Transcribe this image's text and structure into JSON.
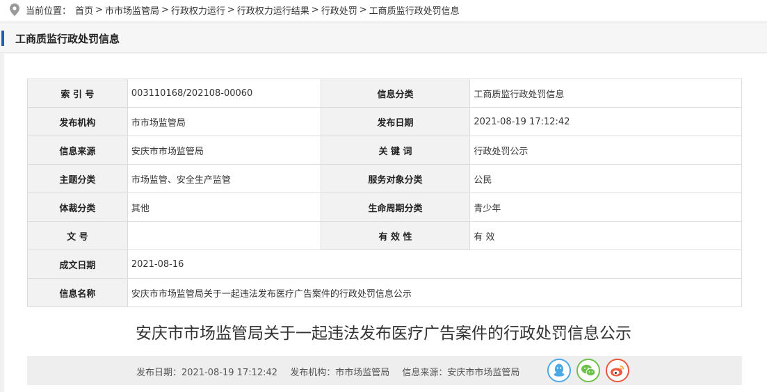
{
  "breadcrumb": {
    "prefix": "当前位置：",
    "items": [
      "首页",
      "市市场监管局",
      "行政权力运行",
      "行政权力运行结果",
      "行政处罚",
      "工商质监行政处罚信息"
    ],
    "separators": [
      ">",
      ">",
      ">",
      ">",
      ">"
    ]
  },
  "section": {
    "title": "工商质监行政处罚信息",
    "accent_color": "#1f5fb3"
  },
  "meta": {
    "index_label": "索 引 号",
    "index_value": "003110168/202108-00060",
    "category_label": "信息分类",
    "category_value": "工商质监行政处罚信息",
    "publisher_label": "发布机构",
    "publisher_value": "市市场监管局",
    "pubdate_label": "发布日期",
    "pubdate_value": "2021-08-19 17:12:42",
    "source_label": "信息来源",
    "source_value": "安庆市市场监管局",
    "keywords_label": "关 键 词",
    "keywords_value": "行政处罚公示",
    "topic_label": "主题分类",
    "topic_value": "市场监管、安全生产监管",
    "audience_label": "服务对象分类",
    "audience_value": "公民",
    "genre_label": "体裁分类",
    "genre_value": "其他",
    "lifecycle_label": "生命周期分类",
    "lifecycle_value": "青少年",
    "docno_label": "文 号",
    "docno_value": "",
    "validity_label": "有 效 性",
    "validity_value": "有 效",
    "date_label": "成文日期",
    "date_value": "2021-08-16",
    "name_label": "信息名称",
    "name_value": "安庆市市场监管局关于一起违法发布医疗广告案件的行政处罚信息公示"
  },
  "article": {
    "title": "安庆市市场监管局关于一起违法发布医疗广告案件的行政处罚信息公示",
    "pubdate": "发布日期：2021-08-19 17:12:42",
    "publisher": "发布机构：市市场监管局",
    "source": "信息来源：安庆市市场监管局"
  },
  "share": {
    "icons": [
      "qq-icon",
      "wechat-icon",
      "weibo-icon"
    ],
    "colors": {
      "qq": "#4aa9e6",
      "wechat": "#6dc04a",
      "weibo": "#e8593e"
    }
  }
}
